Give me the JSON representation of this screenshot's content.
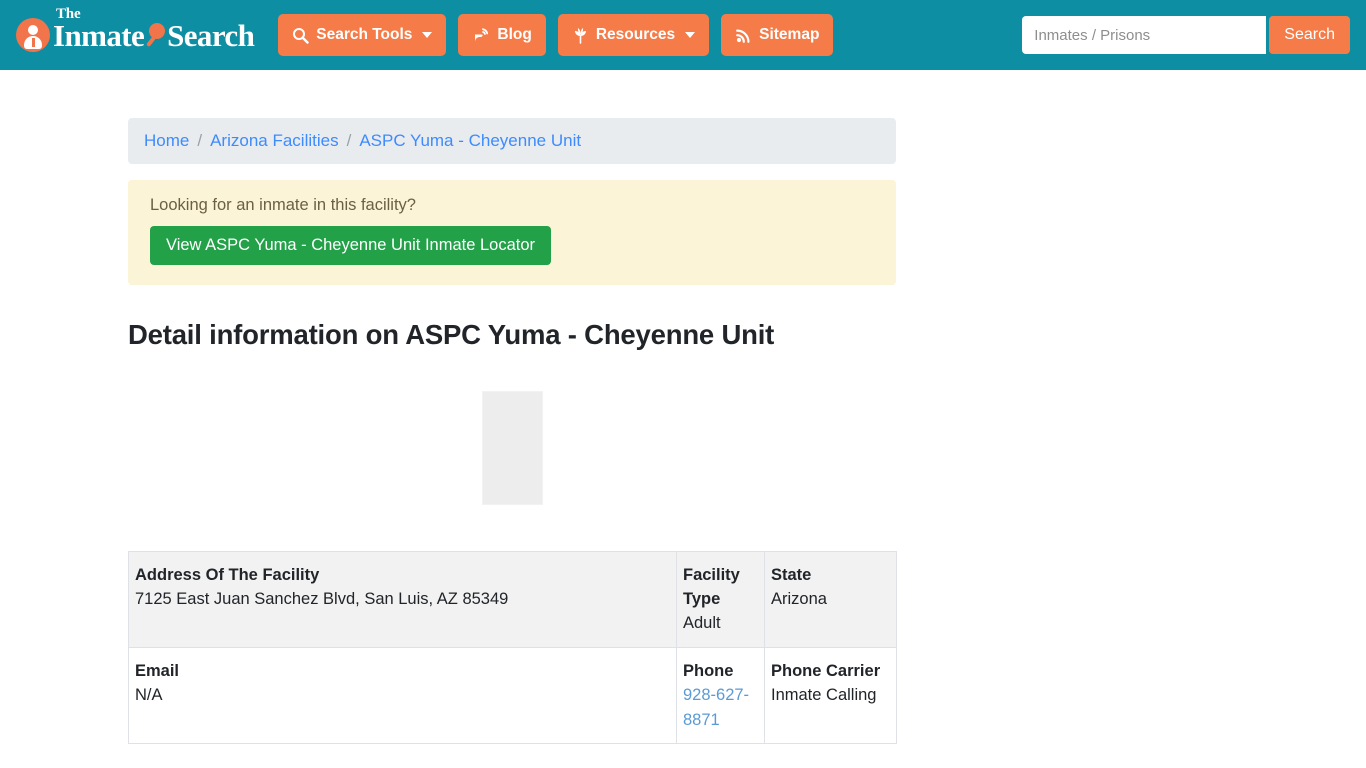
{
  "header": {
    "brand": {
      "the": "The",
      "word1": "Inmate",
      "word2": "Search",
      "badge_icon": "person-icon",
      "glass_icon": "magnifier-icon",
      "teal": "#0d8ea2",
      "orange": "#f57c48"
    },
    "nav": [
      {
        "label": "Search Tools",
        "icon": "magnifier-icon",
        "has_caret": true
      },
      {
        "label": "Blog",
        "icon": "blog-icon",
        "has_caret": false
      },
      {
        "label": "Resources",
        "icon": "leaf-icon",
        "has_caret": true
      },
      {
        "label": "Sitemap",
        "icon": "rss-icon",
        "has_caret": false
      }
    ],
    "search": {
      "placeholder": "Inmates / Prisons",
      "value": "",
      "button_label": "Search"
    }
  },
  "breadcrumb": {
    "items": [
      {
        "label": "Home",
        "current": false
      },
      {
        "label": "Arizona Facilities",
        "current": false
      },
      {
        "label": "ASPC Yuma - Cheyenne Unit",
        "current": true
      }
    ],
    "separator": "/"
  },
  "alert": {
    "title": "Looking for an inmate in this facility?",
    "button_label": "View ASPC Yuma - Cheyenne Unit Inmate Locator",
    "button_color": "#22a148",
    "background": "#fcf4d6"
  },
  "page_title": "Detail information on ASPC Yuma - Cheyenne Unit",
  "facility_image": {
    "alt": "",
    "state": "broken-image-placeholder"
  },
  "detail_table": {
    "rows": [
      {
        "striped": true,
        "cells": [
          {
            "label": "Address Of The Facility",
            "value": "7125 East Juan Sanchez Blvd, San Luis, AZ 85349",
            "link": false
          },
          {
            "label": "Facility Type",
            "value": "Adult",
            "link": false
          },
          {
            "label": "State",
            "value": "Arizona",
            "link": false
          }
        ]
      },
      {
        "striped": false,
        "cells": [
          {
            "label": "Email",
            "value": "N/A",
            "link": false
          },
          {
            "label": "Phone",
            "value": "928-627-8871",
            "link": true
          },
          {
            "label": "Phone Carrier",
            "value": "Inmate Calling",
            "link": false
          }
        ]
      }
    ]
  }
}
